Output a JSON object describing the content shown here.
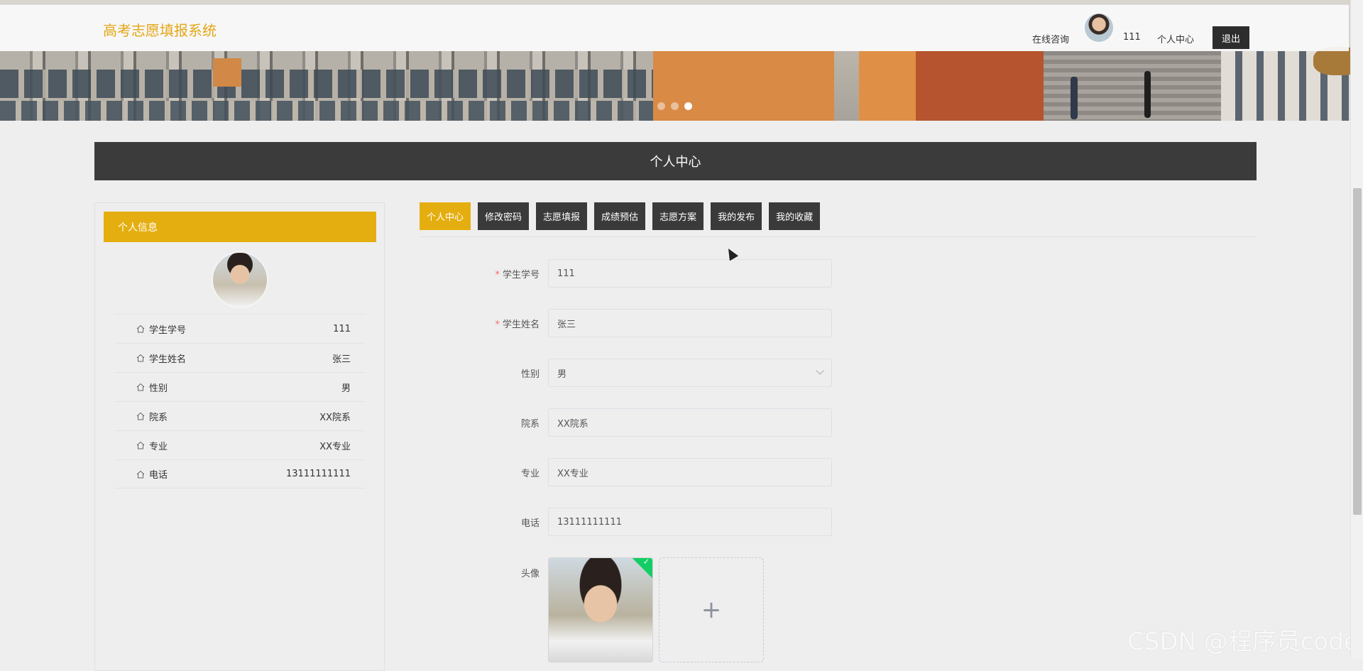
{
  "nav": {
    "site_title": "高考志愿填报系统",
    "consult": "在线咨询",
    "username": "111",
    "center": "个人中心",
    "logout": "退出"
  },
  "banner": {
    "dots": 3,
    "active_dot": 3
  },
  "section": {
    "title": "个人中心"
  },
  "left_card": {
    "title": "个人信息",
    "rows": [
      {
        "label": "学生学号",
        "value": "111"
      },
      {
        "label": "学生姓名",
        "value": "张三"
      },
      {
        "label": "性别",
        "value": "男"
      },
      {
        "label": "院系",
        "value": "XX院系"
      },
      {
        "label": "专业",
        "value": "XX专业"
      },
      {
        "label": "电话",
        "value": "13111111111"
      }
    ]
  },
  "tabs": [
    {
      "label": "个人中心",
      "active": true
    },
    {
      "label": "修改密码"
    },
    {
      "label": "志愿填报"
    },
    {
      "label": "成绩预估"
    },
    {
      "label": "志愿方案"
    },
    {
      "label": "我的发布"
    },
    {
      "label": "我的收藏"
    }
  ],
  "form": {
    "student_no": {
      "label": "学生学号",
      "value": "111",
      "required": true
    },
    "student_name": {
      "label": "学生姓名",
      "value": "张三",
      "required": true
    },
    "gender": {
      "label": "性别",
      "value": "男"
    },
    "department": {
      "label": "院系",
      "value": "XX院系"
    },
    "major": {
      "label": "专业",
      "value": "XX专业"
    },
    "phone": {
      "label": "电话",
      "value": "13111111111"
    },
    "avatar": {
      "label": "头像",
      "add": "+"
    }
  },
  "watermark": "CSDN @程序员code",
  "colors": {
    "accent": "#e5ae10",
    "dark": "#3a3a3a",
    "required": "#f56c6c",
    "success": "#13ce66"
  }
}
